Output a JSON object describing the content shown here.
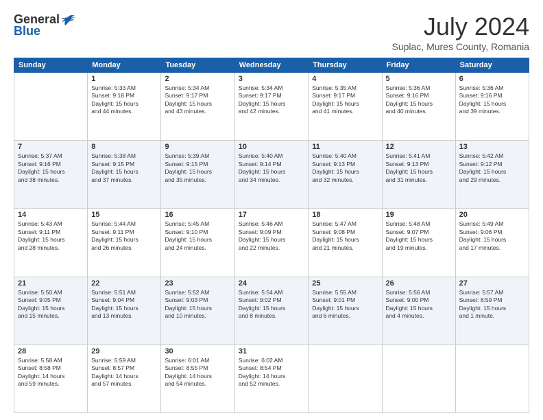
{
  "header": {
    "logo_general": "General",
    "logo_blue": "Blue",
    "month": "July 2024",
    "location": "Suplac, Mures County, Romania"
  },
  "weekdays": [
    "Sunday",
    "Monday",
    "Tuesday",
    "Wednesday",
    "Thursday",
    "Friday",
    "Saturday"
  ],
  "weeks": [
    [
      {
        "day": "",
        "info": ""
      },
      {
        "day": "1",
        "info": "Sunrise: 5:33 AM\nSunset: 9:18 PM\nDaylight: 15 hours\nand 44 minutes."
      },
      {
        "day": "2",
        "info": "Sunrise: 5:34 AM\nSunset: 9:17 PM\nDaylight: 15 hours\nand 43 minutes."
      },
      {
        "day": "3",
        "info": "Sunrise: 5:34 AM\nSunset: 9:17 PM\nDaylight: 15 hours\nand 42 minutes."
      },
      {
        "day": "4",
        "info": "Sunrise: 5:35 AM\nSunset: 9:17 PM\nDaylight: 15 hours\nand 41 minutes."
      },
      {
        "day": "5",
        "info": "Sunrise: 5:36 AM\nSunset: 9:16 PM\nDaylight: 15 hours\nand 40 minutes."
      },
      {
        "day": "6",
        "info": "Sunrise: 5:36 AM\nSunset: 9:16 PM\nDaylight: 15 hours\nand 39 minutes."
      }
    ],
    [
      {
        "day": "7",
        "info": "Sunrise: 5:37 AM\nSunset: 9:16 PM\nDaylight: 15 hours\nand 38 minutes."
      },
      {
        "day": "8",
        "info": "Sunrise: 5:38 AM\nSunset: 9:15 PM\nDaylight: 15 hours\nand 37 minutes."
      },
      {
        "day": "9",
        "info": "Sunrise: 5:39 AM\nSunset: 9:15 PM\nDaylight: 15 hours\nand 35 minutes."
      },
      {
        "day": "10",
        "info": "Sunrise: 5:40 AM\nSunset: 9:14 PM\nDaylight: 15 hours\nand 34 minutes."
      },
      {
        "day": "11",
        "info": "Sunrise: 5:40 AM\nSunset: 9:13 PM\nDaylight: 15 hours\nand 32 minutes."
      },
      {
        "day": "12",
        "info": "Sunrise: 5:41 AM\nSunset: 9:13 PM\nDaylight: 15 hours\nand 31 minutes."
      },
      {
        "day": "13",
        "info": "Sunrise: 5:42 AM\nSunset: 9:12 PM\nDaylight: 15 hours\nand 29 minutes."
      }
    ],
    [
      {
        "day": "14",
        "info": "Sunrise: 5:43 AM\nSunset: 9:11 PM\nDaylight: 15 hours\nand 28 minutes."
      },
      {
        "day": "15",
        "info": "Sunrise: 5:44 AM\nSunset: 9:11 PM\nDaylight: 15 hours\nand 26 minutes."
      },
      {
        "day": "16",
        "info": "Sunrise: 5:45 AM\nSunset: 9:10 PM\nDaylight: 15 hours\nand 24 minutes."
      },
      {
        "day": "17",
        "info": "Sunrise: 5:46 AM\nSunset: 9:09 PM\nDaylight: 15 hours\nand 22 minutes."
      },
      {
        "day": "18",
        "info": "Sunrise: 5:47 AM\nSunset: 9:08 PM\nDaylight: 15 hours\nand 21 minutes."
      },
      {
        "day": "19",
        "info": "Sunrise: 5:48 AM\nSunset: 9:07 PM\nDaylight: 15 hours\nand 19 minutes."
      },
      {
        "day": "20",
        "info": "Sunrise: 5:49 AM\nSunset: 9:06 PM\nDaylight: 15 hours\nand 17 minutes."
      }
    ],
    [
      {
        "day": "21",
        "info": "Sunrise: 5:50 AM\nSunset: 9:05 PM\nDaylight: 15 hours\nand 15 minutes."
      },
      {
        "day": "22",
        "info": "Sunrise: 5:51 AM\nSunset: 9:04 PM\nDaylight: 15 hours\nand 13 minutes."
      },
      {
        "day": "23",
        "info": "Sunrise: 5:52 AM\nSunset: 9:03 PM\nDaylight: 15 hours\nand 10 minutes."
      },
      {
        "day": "24",
        "info": "Sunrise: 5:54 AM\nSunset: 9:02 PM\nDaylight: 15 hours\nand 8 minutes."
      },
      {
        "day": "25",
        "info": "Sunrise: 5:55 AM\nSunset: 9:01 PM\nDaylight: 15 hours\nand 6 minutes."
      },
      {
        "day": "26",
        "info": "Sunrise: 5:56 AM\nSunset: 9:00 PM\nDaylight: 15 hours\nand 4 minutes."
      },
      {
        "day": "27",
        "info": "Sunrise: 5:57 AM\nSunset: 8:59 PM\nDaylight: 15 hours\nand 1 minute."
      }
    ],
    [
      {
        "day": "28",
        "info": "Sunrise: 5:58 AM\nSunset: 8:58 PM\nDaylight: 14 hours\nand 59 minutes."
      },
      {
        "day": "29",
        "info": "Sunrise: 5:59 AM\nSunset: 8:57 PM\nDaylight: 14 hours\nand 57 minutes."
      },
      {
        "day": "30",
        "info": "Sunrise: 6:01 AM\nSunset: 8:55 PM\nDaylight: 14 hours\nand 54 minutes."
      },
      {
        "day": "31",
        "info": "Sunrise: 6:02 AM\nSunset: 8:54 PM\nDaylight: 14 hours\nand 52 minutes."
      },
      {
        "day": "",
        "info": ""
      },
      {
        "day": "",
        "info": ""
      },
      {
        "day": "",
        "info": ""
      }
    ]
  ]
}
